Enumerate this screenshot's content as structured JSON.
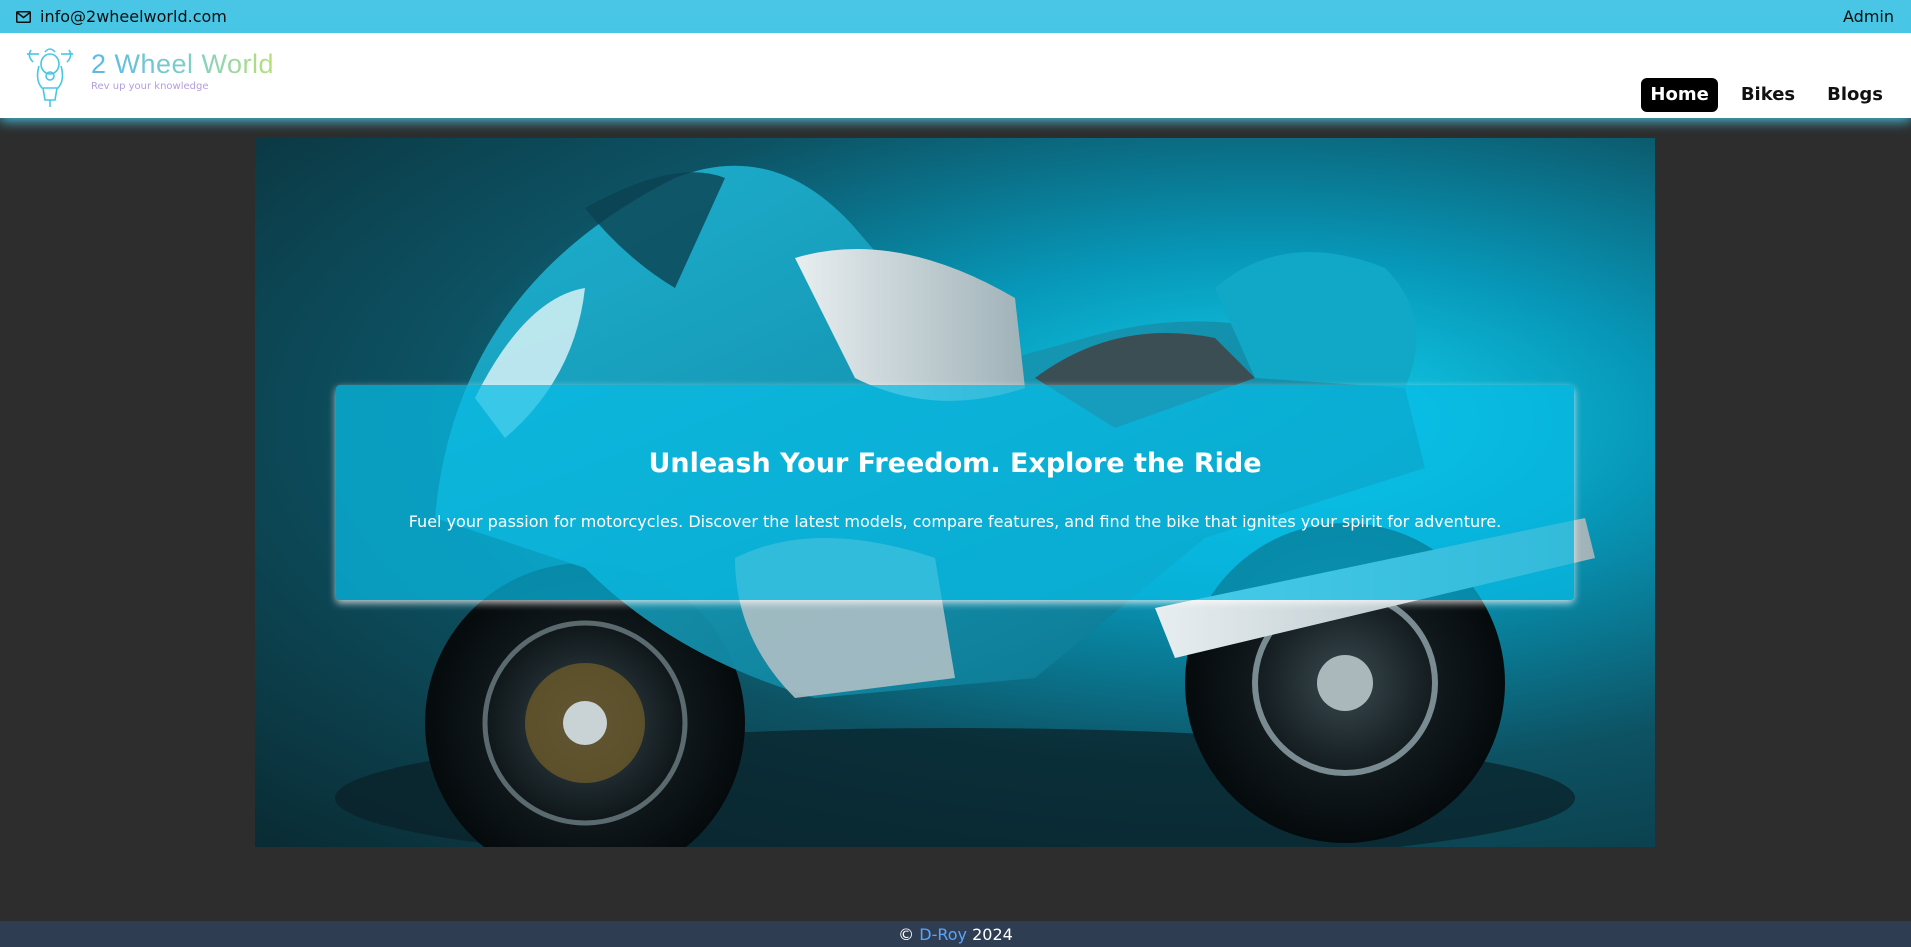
{
  "topbar": {
    "email": "info@2wheelworld.com",
    "admin_label": "Admin"
  },
  "brand": {
    "name": "2 Wheel World",
    "tagline": "Rev up your knowledge"
  },
  "nav": {
    "items": [
      {
        "label": "Home",
        "active": true
      },
      {
        "label": "Bikes",
        "active": false
      },
      {
        "label": "Blogs",
        "active": false
      }
    ]
  },
  "hero": {
    "title": "Unleash Your Freedom. Explore the Ride",
    "subtitle": "Fuel your passion for motorcycles. Discover the latest models, compare features, and find the bike that ignites your spirit for adventure.",
    "image_icon": "motorcycle-image"
  },
  "footer": {
    "copyright_symbol": "©",
    "author": "D-Roy",
    "year": "2024"
  },
  "colors": {
    "topbar": "#49c6e5",
    "nav_active_bg": "#000000",
    "hero_card": "#08bde6",
    "footer_bg": "#2f3d52",
    "footer_link": "#5aa4ff",
    "page_bg": "#2d2d2d"
  }
}
